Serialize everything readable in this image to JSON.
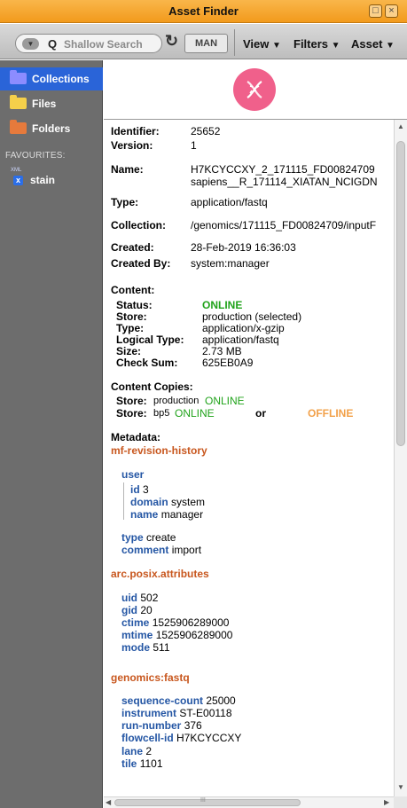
{
  "window": {
    "title": "Asset Finder",
    "restore_glyph": "□",
    "close_glyph": "×"
  },
  "toolbar": {
    "search_dropdown_glyph": "▼",
    "search_icon_glyph": "Q",
    "search_placeholder": "Shallow Search",
    "refresh_glyph": "↻",
    "man_label": "MAN",
    "menus": [
      "View",
      "Filters",
      "Asset"
    ],
    "menu_arrow": "▼"
  },
  "sidebar": {
    "items": [
      {
        "label": "Collections",
        "active": true,
        "color": "#8c8cff"
      },
      {
        "label": "Files",
        "active": false,
        "color": "#f5d04a"
      },
      {
        "label": "Folders",
        "active": false,
        "color": "#e67a3c"
      }
    ],
    "favourites_title": "FAVOURITES:",
    "favourites": [
      {
        "label": "stain",
        "type_small": "XML",
        "badge": "x"
      }
    ]
  },
  "asset": {
    "identifier_label": "Identifier:",
    "identifier": "25652",
    "version_label": "Version:",
    "version": "1",
    "name_label": "Name:",
    "name_line1": "H7KCYCCXY_2_171115_FD00824709",
    "name_line2": "sapiens__R_171114_XIATAN_NCIGDN",
    "type_label": "Type:",
    "type": "application/fastq",
    "collection_label": "Collection:",
    "collection": "/genomics/171115_FD00824709/inputF",
    "created_label": "Created:",
    "created": "28-Feb-2019 16:36:03",
    "created_by_label": "Created By:",
    "created_by": "system:manager"
  },
  "content": {
    "title": "Content:",
    "status_label": "Status:",
    "status": "ONLINE",
    "store_label": "Store:",
    "store": "production (selected)",
    "type_label": "Type:",
    "type": "application/x-gzip",
    "logical_type_label": "Logical Type:",
    "logical_type": "application/fastq",
    "size_label": "Size:",
    "size": "2.73 MB",
    "checksum_label": "Check Sum:",
    "checksum": "625EB0A9"
  },
  "copies": {
    "title": "Content Copies:",
    "store_label": "Store:",
    "store1_name": "production",
    "store1_status": "ONLINE",
    "store2_name": "bp5",
    "store2_status": "ONLINE",
    "or_text": "or",
    "offline_text": "OFFLINE"
  },
  "metadata": {
    "title": "Metadata:",
    "revision": {
      "title": "mf-revision-history",
      "user_key": "user",
      "id_key": "id",
      "id": "3",
      "domain_key": "domain",
      "domain": "system",
      "name_key": "name",
      "name": "manager",
      "type_key": "type",
      "type": "create",
      "comment_key": "comment",
      "comment": "import"
    },
    "posix": {
      "title": "arc.posix.attributes",
      "uid_key": "uid",
      "uid": "502",
      "gid_key": "gid",
      "gid": "20",
      "ctime_key": "ctime",
      "ctime": "1525906289000",
      "mtime_key": "mtime",
      "mtime": "1525906289000",
      "mode_key": "mode",
      "mode": "511"
    },
    "fastq": {
      "title": "genomics:fastq",
      "seq_key": "sequence-count",
      "seq": "25000",
      "instrument_key": "instrument",
      "instrument": "ST-E00118",
      "run_key": "run-number",
      "run": "376",
      "flowcell_key": "flowcell-id",
      "flowcell": "H7KCYCCXY",
      "lane_key": "lane",
      "lane": "2",
      "tile_key": "tile",
      "tile": "1101"
    }
  },
  "scroll": {
    "up": "▲",
    "down": "▼",
    "left": "◀",
    "right": "▶",
    "grip": "III"
  },
  "colors": {
    "title_bar": "#f29a1c",
    "sidebar": "#6d6d6d",
    "active_item": "#2a64d8",
    "online": "#21a31b",
    "offline": "#f2a14a",
    "meta_heading": "#c8571e",
    "meta_key": "#2456a4",
    "logo": "#f0608b"
  },
  "icons": {
    "logo": "dna-icon",
    "search": "search-icon",
    "refresh": "refresh-icon",
    "folder": "folder-icon",
    "xml": "xml-file-icon"
  }
}
